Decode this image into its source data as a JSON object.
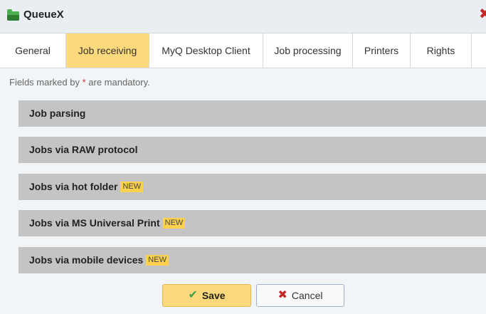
{
  "window": {
    "title": "QueueX",
    "icon": "folder-icon",
    "close_icon": "close-icon"
  },
  "tabs": [
    {
      "label": "General",
      "active": false
    },
    {
      "label": "Job receiving",
      "active": true
    },
    {
      "label": "MyQ Desktop Client",
      "active": false
    },
    {
      "label": "Job processing",
      "active": false
    },
    {
      "label": "Printers",
      "active": false
    },
    {
      "label": "Rights",
      "active": false
    }
  ],
  "form": {
    "mandatory_prefix": "Fields marked by ",
    "mandatory_star": "*",
    "mandatory_suffix": " are mandatory."
  },
  "sections": [
    {
      "label": "Job parsing",
      "badge": ""
    },
    {
      "label": "Jobs via RAW protocol",
      "badge": ""
    },
    {
      "label": "Jobs via hot folder",
      "badge": "NEW"
    },
    {
      "label": "Jobs via MS Universal Print",
      "badge": "NEW"
    },
    {
      "label": "Jobs via mobile devices",
      "badge": "NEW"
    }
  ],
  "buttons": {
    "save": "Save",
    "cancel": "Cancel"
  },
  "colors": {
    "active_tab": "#fcd97c",
    "section_bg": "#c4c4c4",
    "badge_bg": "#fcd14d",
    "mandatory_star": "#d32f2f"
  }
}
